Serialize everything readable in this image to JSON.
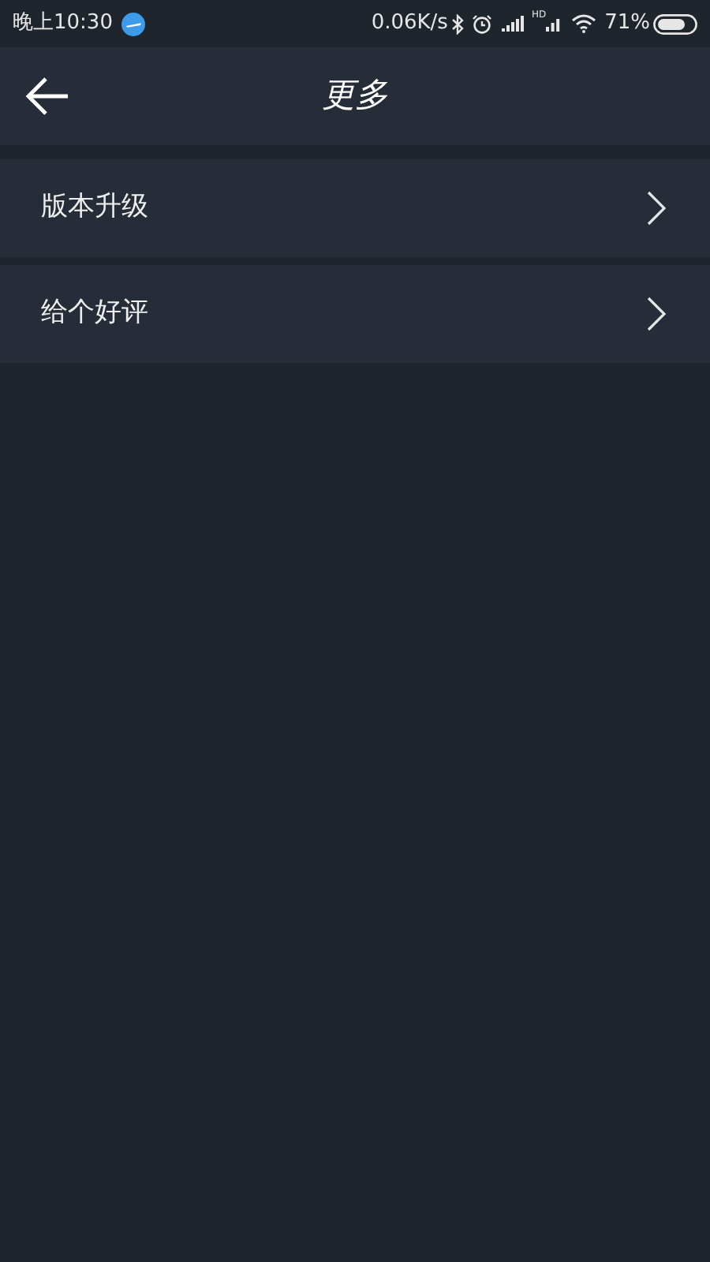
{
  "status_bar": {
    "time": "晚上10:30",
    "speed": "0.06K/s",
    "signal_hd": "HD",
    "battery": "71%"
  },
  "header": {
    "title": "更多"
  },
  "items": [
    {
      "label": "版本升级"
    },
    {
      "label": "给个好评"
    }
  ]
}
